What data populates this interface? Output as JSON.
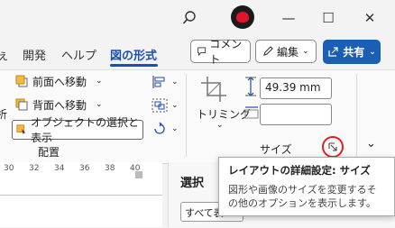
{
  "titlebar": {
    "search_icon": "search-icon",
    "minimize": "—",
    "maximize": "☐",
    "close": "✕"
  },
  "tabs": [
    {
      "label": "ぇ"
    },
    {
      "label": "開発"
    },
    {
      "label": "ヘルプ"
    },
    {
      "label": "図の形式"
    }
  ],
  "actions": {
    "comment_label": "コメント",
    "edit_label": "編集",
    "share_label": "共有"
  },
  "ribbon": {
    "left_fragment": "析",
    "arrange": {
      "bring_forward": "前面へ移動",
      "send_backward": "背面へ移動",
      "selection_pane": "オブジェクトの選択と表示",
      "group_label": "配置"
    },
    "size": {
      "crop_label": "トリミング",
      "height_value": "49.39 mm",
      "width_value": "",
      "group_label": "サイズ"
    }
  },
  "ruler": {
    "ticks": [
      "30",
      "32",
      "34",
      "36",
      "38",
      "40"
    ]
  },
  "pane": {
    "title": "選択",
    "search_placeholder": "すべて表"
  },
  "tooltip": {
    "title": "レイアウトの詳細設定: サイズ",
    "body": "図形や画像のサイズを変更するその他のオプションを表示します。"
  },
  "colors": {
    "accent": "#1a4fb5",
    "share_bg": "#1a5fb4",
    "highlight_circle": "#e02020"
  }
}
